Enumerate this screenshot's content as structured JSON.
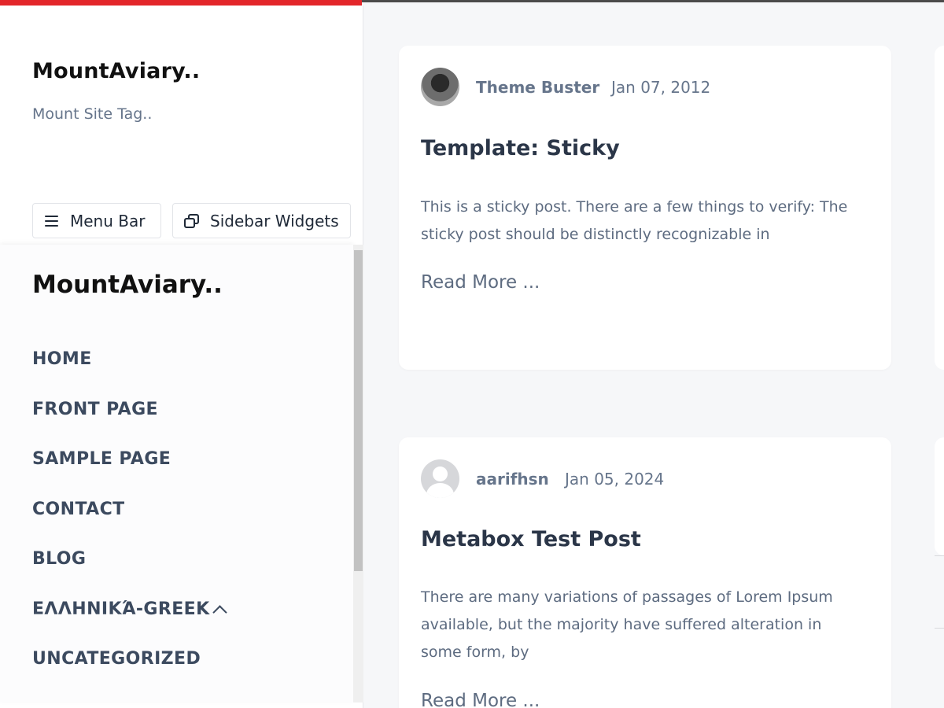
{
  "site": {
    "title": "MountAviary..",
    "tagline": "Mount Site Tag.."
  },
  "toolbar": {
    "menu_label": "Menu Bar",
    "widgets_label": "Sidebar Widgets"
  },
  "menu": {
    "title": "MountAviary..",
    "items": [
      {
        "label": "HOME"
      },
      {
        "label": "FRONT PAGE"
      },
      {
        "label": "SAMPLE PAGE"
      },
      {
        "label": "CONTACT"
      },
      {
        "label": "BLOG"
      },
      {
        "label": "ΕΛΛΗΝΙΚΆ-GREEK",
        "has_submenu": true
      },
      {
        "label": "UNCATEGORIZED"
      }
    ]
  },
  "posts": [
    {
      "author": "Theme Buster",
      "date": "Jan 07, 2012",
      "title": "Template: Sticky",
      "excerpt": "This is a sticky post. There are a few things to verify: The sticky post should be distinctly recognizable in",
      "read_more": "Read More ..."
    },
    {
      "author": "aarifhsn",
      "date": "Jan 05, 2024",
      "title": "Metabox Test Post",
      "excerpt": "There are many variations of passages of Lorem Ipsum available, but the majority have suffered alteration in some form, by",
      "read_more": "Read More ..."
    }
  ],
  "colors": {
    "accent": "#e3262a",
    "text_muted": "#66758b",
    "heading": "#111111",
    "menu_text": "#3c4a5f"
  }
}
